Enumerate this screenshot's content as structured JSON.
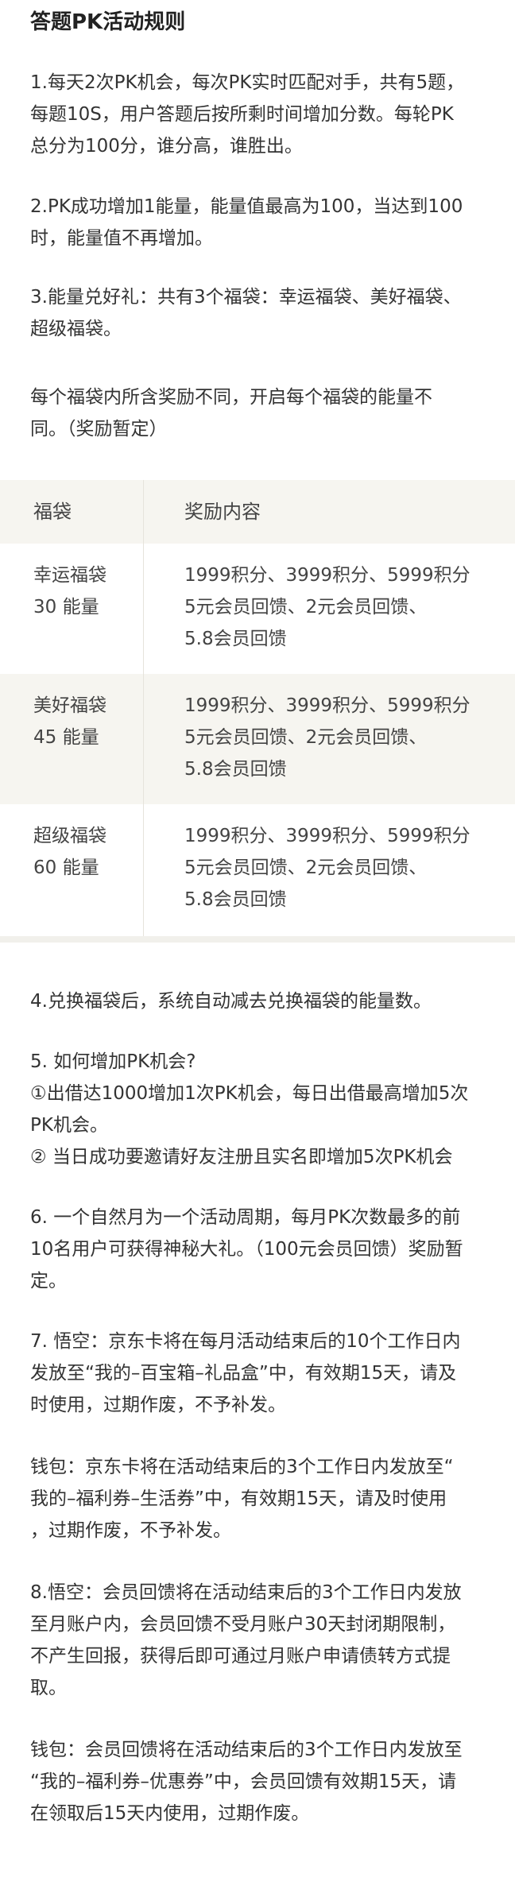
{
  "title": "答题PK活动规则",
  "intro": {
    "rule1": [
      "1.每天2次PK机会，每次PK实时匹配对手，共有5题，",
      "每题10S，用户答题后按所剩时间增加分数。每轮PK",
      "总分为100分，谁分高，谁胜出。"
    ],
    "rule2": [
      "2.PK成功增加1能量，能量值最高为100，当达到100",
      "时，能量值不再增加。"
    ],
    "rule3": [
      "3.能量兑好礼：共有3个福袋：幸运福袋、美好福袋、",
      "超级福袋。"
    ],
    "note": [
      "每个福袋内所含奖励不同，开启每个福袋的能量不",
      "同。（奖励暂定）"
    ]
  },
  "table": {
    "headers": [
      "福袋",
      "奖励内容"
    ],
    "rows": [
      {
        "name": "幸运福袋",
        "energy": "30 能量",
        "rewards": [
          "1999积分、3999积分、5999积分",
          "5元会员回馈、2元会员回馈、",
          "5.8会员回馈"
        ]
      },
      {
        "name": "美好福袋",
        "energy": "45 能量",
        "rewards": [
          "1999积分、3999积分、5999积分",
          "5元会员回馈、2元会员回馈、",
          "5.8会员回馈"
        ]
      },
      {
        "name": "超级福袋",
        "energy": "60 能量",
        "rewards": [
          "1999积分、3999积分、5999积分",
          "5元会员回馈、2元会员回馈、",
          "5.8会员回馈"
        ]
      }
    ]
  },
  "rules": {
    "rule4": [
      "4.兑换福袋后，系统自动减去兑换福袋的能量数。"
    ],
    "rule5": [
      "5. 如何增加PK机会?",
      "①出借达1000增加1次PK机会，每日出借最高增加5次",
      "PK机会。",
      "② 当日成功要邀请好友注册且实名即增加5次PK机会"
    ],
    "rule6": [
      "6. 一个自然月为一个活动周期，每月PK次数最多的前",
      "10名用户可获得神秘大礼。（100元会员回馈）奖励暂",
      "定。"
    ],
    "rule7": [
      "7.  悟空：京东卡将在每月活动结束后的10个工作日内",
      "发放至“我的–百宝箱–礼品盒”中，有效期15天，请及",
      "时使用，过期作废，不予补发。"
    ],
    "rule7b": [
      "钱包：京东卡将在活动结束后的3个工作日内发放至“",
      "我的–福利券–生活券”中，有效期15天，请及时使用",
      "，过期作废，不予补发。"
    ],
    "rule8": [
      "8.悟空：会员回馈将在活动结束后的3个工作日内发放",
      "至月账户内，会员回馈不受月账户30天封闭期限制，",
      "不产生回报，获得后即可通过月账户申请债转方式提",
      "取。"
    ],
    "rule8b": [
      "钱包：会员回馈将在活动结束后的3个工作日内发放至",
      "“我的–福利券–优惠券”中，会员回馈有效期15天，请",
      "在领取后15天内使用，过期作废。"
    ]
  }
}
